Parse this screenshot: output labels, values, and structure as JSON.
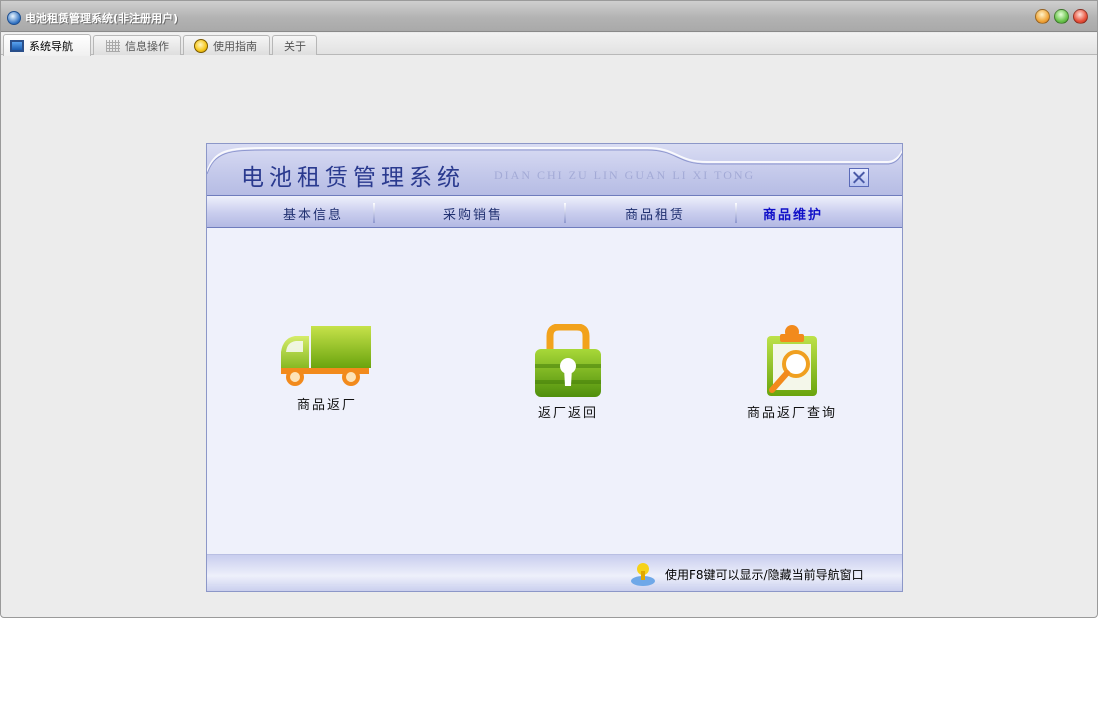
{
  "window": {
    "title": "电池租赁管理系统(非注册用户)",
    "icons": {
      "app": "app-logo-icon",
      "minimize": "minimize-icon",
      "maximize": "maximize-icon",
      "close": "close-icon"
    }
  },
  "tabs": [
    {
      "label": "系统导航",
      "icon": "monitor-icon",
      "active": true
    },
    {
      "label": "信息操作",
      "icon": "grid-icon",
      "active": false
    },
    {
      "label": "使用指南",
      "icon": "lightbulb-icon",
      "active": false
    },
    {
      "label": "关于",
      "icon": "",
      "active": false
    }
  ],
  "navigator": {
    "title": "电池租赁管理系统",
    "subtitle": "DIAN CHI ZU LIN GUAN LI XI TONG",
    "menu": [
      {
        "label": "基本信息",
        "active": false
      },
      {
        "label": "采购销售",
        "active": false
      },
      {
        "label": "商品租赁",
        "active": false
      },
      {
        "label": "商品维护",
        "active": true
      }
    ],
    "tiles": [
      {
        "label": "商品返厂",
        "icon": "truck-icon"
      },
      {
        "label": "返厂返回",
        "icon": "lock-icon"
      },
      {
        "label": "商品返厂查询",
        "icon": "clipboard-search-icon"
      }
    ],
    "footer_hint": "使用F8键可以显示/隐藏当前导航窗口",
    "colors": {
      "accent": "#2a3a8f",
      "active_menu": "#1010c8",
      "panel_bg": "#eff1fb"
    }
  }
}
